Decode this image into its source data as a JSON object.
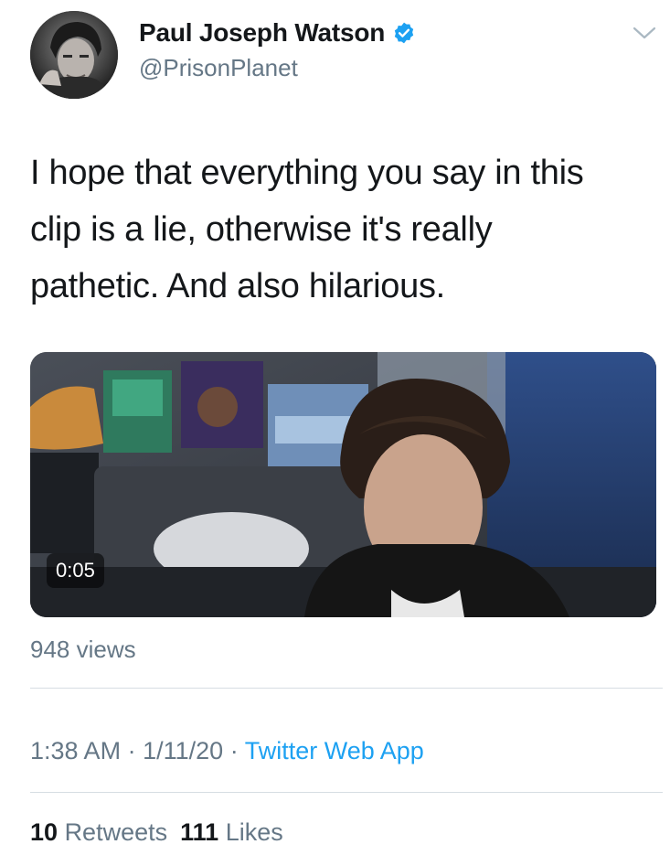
{
  "author": {
    "display_name": "Paul Joseph Watson",
    "handle": "@PrisonPlanet",
    "verified": true
  },
  "tweet": {
    "text": "I hope that everything you say in this\nclip is a lie, otherwise it's really\npathetic. And also hilarious."
  },
  "video": {
    "duration": "0:05",
    "views": "948 views"
  },
  "meta": {
    "time": "1:38 AM",
    "separator": "·",
    "date": "1/11/20",
    "source": "Twitter Web App"
  },
  "stats": {
    "retweets_count": "10",
    "retweets_label": "Retweets",
    "likes_count": "111",
    "likes_label": "Likes"
  },
  "colors": {
    "accent": "#1da1f2",
    "secondary_text": "#657786",
    "primary_text": "#14171a",
    "divider": "#d6dde3"
  },
  "icons": [
    "avatar",
    "verified-badge-icon",
    "chevron-down-icon"
  ]
}
